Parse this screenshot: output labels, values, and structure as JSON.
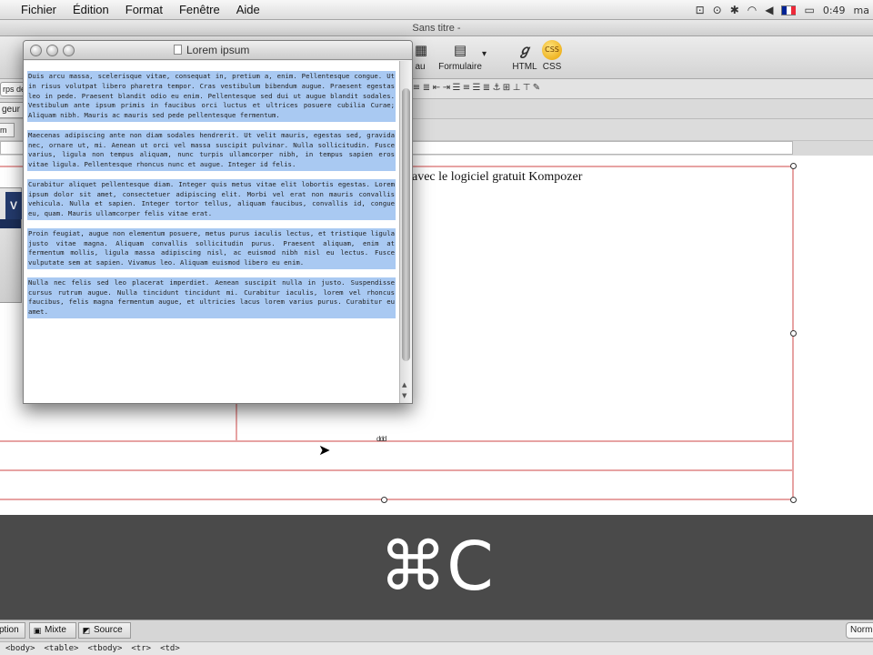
{
  "menubar": {
    "items": [
      "Fichier",
      "Édition",
      "Format",
      "Fenêtre",
      "Aide"
    ],
    "clock": "0:49",
    "user": "ma",
    "flag_colors": [
      "#002395",
      "#ffffff",
      "#ed2939"
    ],
    "status_icons": [
      "time-machine-icon",
      "sync-icon",
      "bluetooth-icon",
      "wifi-icon",
      "volume-icon",
      "battery-icon"
    ]
  },
  "window": {
    "title": "Sans titre -"
  },
  "toolbar": {
    "tab_label_partial": "au",
    "form_label": "Formulaire",
    "html_label": "HTML",
    "css_label": "CSS",
    "css_badge": "CSS"
  },
  "formatbar": {
    "select_value": "rps de"
  },
  "tabrow": {
    "tab_partial": "geur"
  },
  "strip": {
    "left_partial": "m"
  },
  "editor": {
    "text_fragment": "avec le logiciel gratuit Kompozer",
    "image_letter": "V",
    "cell_indicator": "ddd"
  },
  "float_window": {
    "title": "Lorem ipsum",
    "paragraphs": [
      "Duis arcu massa, scelerisque vitae, consequat in, pretium a, enim. Pellentesque congue. Ut in risus volutpat libero pharetra tempor. Cras vestibulum bibendum augue. Praesent egestas leo in pede. Praesent blandit odio eu enim. Pellentesque sed dui ut augue blandit sodales. Vestibulum ante ipsum primis in faucibus orci luctus et ultrices posuere cubilia Curae; Aliquam nibh. Mauris ac mauris sed pede pellentesque fermentum.",
      "Maecenas adipiscing ante non diam sodales hendrerit. Ut velit mauris, egestas sed, gravida nec, ornare ut, mi. Aenean ut orci vel massa suscipit pulvinar. Nulla sollicitudin. Fusce varius, ligula non tempus aliquam, nunc turpis ullamcorper nibh, in tempus sapien eros vitae ligula. Pellentesque rhoncus nunc et augue. Integer id felis.",
      "Curabitur aliquet pellentesque diam. Integer quis metus vitae elit lobortis egestas. Lorem ipsum dolor sit amet, consectetuer adipiscing elit. Morbi vel erat non mauris convallis vehicula. Nulla et sapien. Integer tortor tellus, aliquam faucibus, convallis id, congue eu, quam. Mauris ullamcorper felis vitae erat.",
      "Proin feugiat, augue non elementum posuere, metus purus iaculis lectus, et tristique ligula justo vitae magna. Aliquam convallis sollicitudin purus. Praesent aliquam, enim at fermentum mollis, ligula massa adipiscing nisl, ac euismod nibh nisl eu lectus. Fusce vulputate sem at sapien. Vivamus leo. Aliquam euismod libero eu enim.",
      "Nulla nec felis sed leo placerat imperdiet. Aenean suscipit nulla in justo. Suspendisse cursus rutrum augue. Nulla tincidunt tincidunt mi. Curabitur iaculis, lorem vel rhoncus faucibus, felis magna fermentum augue, et ultricies lacus lorem varius purus. Curabitur eu amet."
    ]
  },
  "overlay": {
    "shortcut": "⌘C"
  },
  "bottom_tabs": {
    "design": "ption",
    "mixed": "Mixte",
    "source": "Source"
  },
  "mode_select": {
    "value": "Norm"
  },
  "statusbar": {
    "breadcrumbs": [
      "<body>",
      "<table>",
      "<tbody>",
      "<tr>",
      "<td>"
    ]
  }
}
